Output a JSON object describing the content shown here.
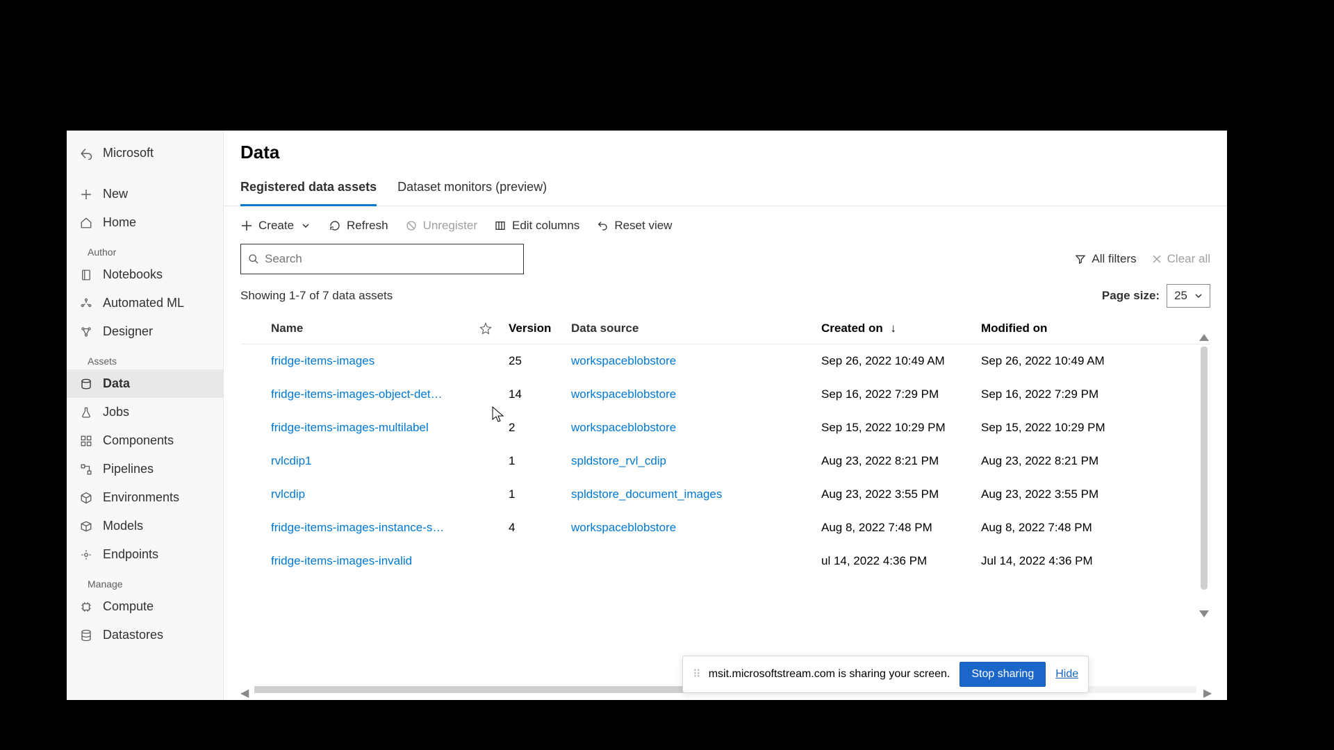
{
  "sidebar": {
    "workspace": "Microsoft",
    "new_label": "New",
    "home_label": "Home",
    "groups": {
      "author": "Author",
      "assets": "Assets",
      "manage": "Manage"
    },
    "author_items": [
      "Notebooks",
      "Automated ML",
      "Designer"
    ],
    "asset_items": [
      "Data",
      "Jobs",
      "Components",
      "Pipelines",
      "Environments",
      "Models",
      "Endpoints"
    ],
    "manage_items": [
      "Compute",
      "Datastores"
    ]
  },
  "page": {
    "title": "Data"
  },
  "tabs": [
    "Registered data assets",
    "Dataset monitors (preview)"
  ],
  "toolbar": {
    "create": "Create",
    "refresh": "Refresh",
    "unregister": "Unregister",
    "edit_columns": "Edit columns",
    "reset_view": "Reset view"
  },
  "search": {
    "placeholder": "Search"
  },
  "filters": {
    "all_filters": "All filters",
    "clear_all": "Clear all"
  },
  "result_summary": "Showing 1-7 of 7 data assets",
  "page_size": {
    "label": "Page size:",
    "value": "25"
  },
  "columns": {
    "name": "Name",
    "version": "Version",
    "datasource": "Data source",
    "created": "Created on",
    "modified": "Modified on"
  },
  "rows": [
    {
      "name": "fridge-items-images",
      "version": "25",
      "datasource": "workspaceblobstore",
      "created": "Sep 26, 2022 10:49 AM",
      "modified": "Sep 26, 2022 10:49 AM"
    },
    {
      "name": "fridge-items-images-object-det…",
      "version": "14",
      "datasource": "workspaceblobstore",
      "created": "Sep 16, 2022 7:29 PM",
      "modified": "Sep 16, 2022 7:29 PM"
    },
    {
      "name": "fridge-items-images-multilabel",
      "version": "2",
      "datasource": "workspaceblobstore",
      "created": "Sep 15, 2022 10:29 PM",
      "modified": "Sep 15, 2022 10:29 PM"
    },
    {
      "name": "rvlcdip1",
      "version": "1",
      "datasource": "spldstore_rvl_cdip",
      "created": "Aug 23, 2022 8:21 PM",
      "modified": "Aug 23, 2022 8:21 PM"
    },
    {
      "name": "rvlcdip",
      "version": "1",
      "datasource": "spldstore_document_images",
      "created": "Aug 23, 2022 3:55 PM",
      "modified": "Aug 23, 2022 3:55 PM"
    },
    {
      "name": "fridge-items-images-instance-s…",
      "version": "4",
      "datasource": "workspaceblobstore",
      "created": "Aug 8, 2022 7:48 PM",
      "modified": "Aug 8, 2022 7:48 PM"
    },
    {
      "name": "fridge-items-images-invalid",
      "version": "",
      "datasource": "",
      "created": "ul 14, 2022 4:36 PM",
      "modified": "Jul 14, 2022 4:36 PM"
    }
  ],
  "share_notice": {
    "text": "msit.microsoftstream.com is sharing your screen.",
    "stop": "Stop sharing",
    "hide": "Hide"
  }
}
